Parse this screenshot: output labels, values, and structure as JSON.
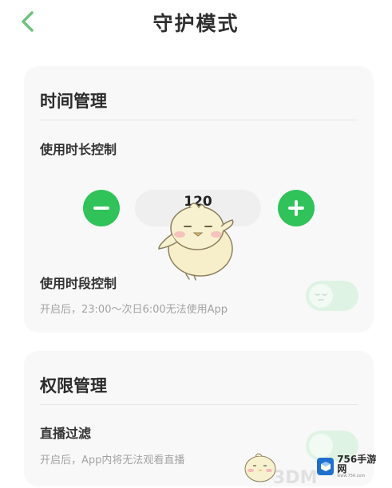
{
  "header": {
    "title": "守护模式"
  },
  "time_section": {
    "title": "时间管理",
    "duration": {
      "label": "使用时长控制",
      "value": "120"
    },
    "period": {
      "label": "使用时段控制",
      "desc": "开启后，23:00～次日6:00无法使用App",
      "enabled": false
    }
  },
  "perm_section": {
    "title": "权限管理",
    "live_filter": {
      "label": "直播过滤",
      "desc": "开启后，App内将无法观看直播",
      "enabled": false
    }
  },
  "watermark": {
    "brand": "756手游网",
    "url": "www.756.com",
    "text": "3DM"
  },
  "colors": {
    "accent": "#2fc35a",
    "toggle_off": "#dff3e4",
    "card_bg": "#f8f8f8"
  },
  "icons": {
    "back": "chevron-left-icon",
    "minus": "minus-icon",
    "plus": "plus-icon"
  }
}
